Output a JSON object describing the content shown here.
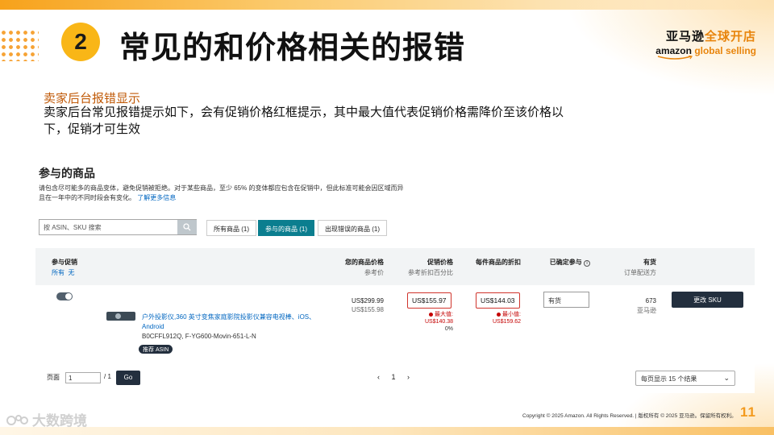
{
  "slide": {
    "number": "2",
    "title": "常见的和价格相关的报错",
    "subtitle": "卖家后台报错显示",
    "description": "卖家后台常见报错提示如下，会有促销价格红框提示，其中最大值代表促销价格需降价至该价格以下，促销才可生效",
    "page_number": "11",
    "copyright": "Copyright © 2025 Amazon. All Rights Reserved. | 版权所有 © 2025 亚马逊。保留所有权利。",
    "watermark": "大数跨境"
  },
  "logo": {
    "cn_black": "亚马逊",
    "cn_orange": "全球开店",
    "en_black": "amazon",
    "en_orange": "global selling"
  },
  "panel": {
    "title": "参与的商品",
    "note": "请包含尽可能多的商品变体，避免促销被拒绝。对于某些商品，至少 65% 的变体都应包含在促销中，但此标准可能会因区域而异且在一年中的不同时段会有变化。",
    "note_link": "了解更多信息",
    "search_placeholder": "按 ASIN、SKU 搜索",
    "tabs": [
      "所有商品 (1)",
      "参与的商品 (1)",
      "出现错误的商品 (1)"
    ],
    "columns": {
      "participate": "参与促销",
      "participate_all": "所有",
      "participate_none": "无",
      "your_price": "您的商品价格",
      "your_price_sub": "参考价",
      "promo_price": "促销价格",
      "promo_price_sub": "参考折扣百分比",
      "unit_discount": "每件商品的折扣",
      "confirmed": "已确定参与",
      "stock": "有货",
      "stock_sub": "订单配送方"
    },
    "row": {
      "product_name": "户外投影仪,360 英寸变焦家庭影院投影仪兼容电视棒、iOS、Android",
      "asin_sku": "B0CFFL912Q, F-YG600-Movin-651-L-N",
      "badge": "推荐 ASIN",
      "your_price": "US$299.99",
      "ref_price": "US$155.98",
      "promo_price": "US$155.97",
      "promo_err_label": "最大值:",
      "promo_err_value": "US$140.38",
      "promo_pct": "0%",
      "unit_discount": "US$144.03",
      "discount_err_label": "最小值:",
      "discount_err_value": "US$159.62",
      "confirmed_value": "有货",
      "stock_count": "673",
      "fulfilled_by": "亚马逊",
      "action": "更改 SKU"
    },
    "pager": {
      "label": "页面",
      "current": "1",
      "total": "/ 1",
      "go": "Go",
      "prev": "‹",
      "page": "1",
      "next": "›",
      "per_page": "每页显示 15 个结果"
    }
  }
}
